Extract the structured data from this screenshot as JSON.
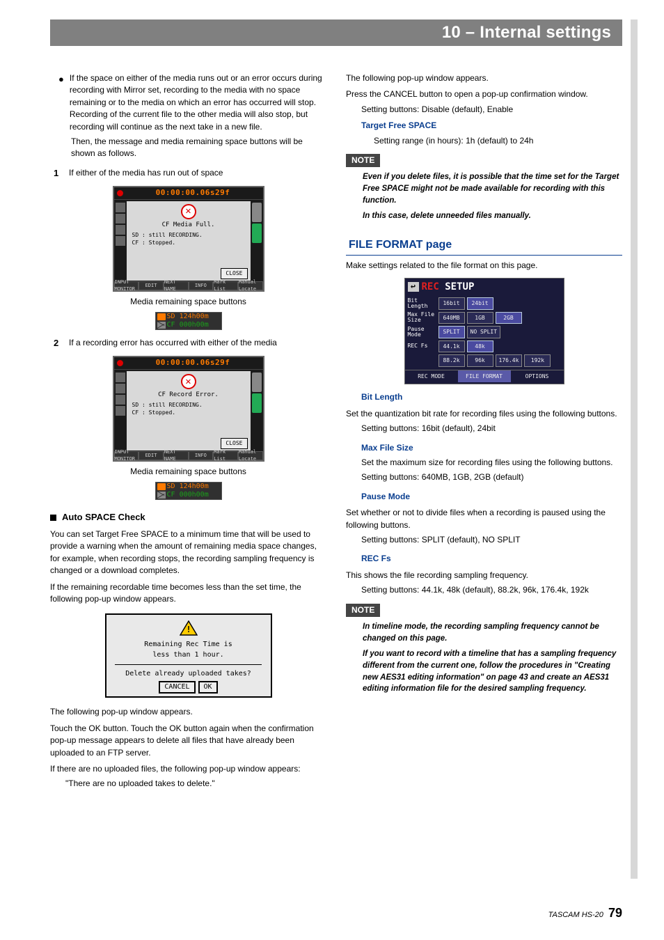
{
  "header": {
    "title": "10 – Internal settings"
  },
  "left": {
    "bullet1": "If the space on either of the media runs out or an error occurs during recording with Mirror set, recording to the media with no space remaining or to the media on which an error has occurred will stop. Recording of the current file to the other media will also stop, but recording will continue as the next take in a new file.",
    "bullet1b": "Then, the message and media remaining space buttons will be shown as follows.",
    "num1_label": "1",
    "num1_text": "If either of the media has run out of space",
    "screen1": {
      "time": "00:00:00.06s29f",
      "title": "CF Media Full.",
      "line1": "SD : still RECORDING.",
      "line2": "CF : Stopped.",
      "close": "CLOSE",
      "tabs": [
        "INPUT MONITOR",
        "EDIT",
        "NEXT NAME",
        "INFO",
        "Mark List",
        "Manual Locate"
      ]
    },
    "caption": "Media remaining space buttons",
    "mini": {
      "sd_label": "SD",
      "sd_val": "124h00m",
      "cf_label": "CF",
      "cf_val": "000h00m"
    },
    "num2_label": "2",
    "num2_text": "If a recording error has occurred with either of the media",
    "screen2": {
      "time": "00:00:00.06s29f",
      "title": "CF Record Error.",
      "line1": "SD : still RECORDING.",
      "line2": "CF : Stopped.",
      "close": "CLOSE",
      "tabs": [
        "INPUT MONITOR",
        "EDIT",
        "NEXT NAME",
        "INFO",
        "Mark List",
        "Manual Locate"
      ]
    },
    "auto_space_heading": "Auto SPACE Check",
    "auto_p1": "You can set Target Free SPACE to a minimum time that will be used to provide a warning when the amount of remaining media space changes, for example, when recording stops, the recording sampling frequency is changed or a download completes.",
    "auto_p2": "If the remaining recordable time becomes less than the set time, the following pop-up window appears.",
    "popup": {
      "l1": "Remaining Rec Time is",
      "l2": "less than 1 hour.",
      "l3": "Delete already uploaded takes?",
      "cancel": "CANCEL",
      "ok": "OK"
    },
    "after_popup1": "The following pop-up window appears.",
    "after_popup2": "Touch the OK button. Touch the OK button again when the confirmation pop-up message appears to delete all files that have already been uploaded to an FTP server.",
    "after_popup3": "If there are no uploaded files, the following pop-up window appears:",
    "after_popup4": "\"There are no uploaded takes to delete.\""
  },
  "right": {
    "p1": "The following pop-up window appears.",
    "p2": "Press the CANCEL button to open a pop-up confirmation window.",
    "p3": "Setting buttons: Disable (default), Enable",
    "tfs_heading": "Target Free SPACE",
    "tfs_body": "Setting range (in hours): 1h (default) to 24h",
    "note1_label": "NOTE",
    "note1_a": "Even if you delete files, it is possible that  the time set for the Target Free SPACE might not be made available for recording with this function.",
    "note1_b": "In this case, delete unneeded files manually.",
    "file_format_heading": "FILE FORMAT page",
    "file_format_intro": "Make settings related to the file format on this page.",
    "rec_setup": {
      "title": "REC SETUP",
      "rows": [
        {
          "label": "Bit Length",
          "buttons": [
            "16bit",
            "24bit"
          ],
          "selected": 1
        },
        {
          "label": "Max File Size",
          "buttons": [
            "640MB",
            "1GB",
            "2GB"
          ],
          "selected": 2
        },
        {
          "label": "Pause Mode",
          "buttons": [
            "SPLIT",
            "NO SPLIT"
          ],
          "selected": 0
        },
        {
          "label": "REC Fs",
          "buttons": [
            "44.1k",
            "48k"
          ],
          "selected": 1
        },
        {
          "label": "",
          "buttons": [
            "88.2k",
            "96k",
            "176.4k",
            "192k"
          ],
          "selected": -1
        }
      ],
      "tabs": [
        "REC MODE",
        "FILE FORMAT",
        "OPTIONS"
      ],
      "active_tab": 1
    },
    "bit_heading": "Bit Length",
    "bit_body": "Set the quantization bit rate for recording files using the following buttons.",
    "bit_setting": "Setting buttons: 16bit (default), 24bit",
    "max_heading": "Max File Size",
    "max_body": "Set the maximum size for recording files using the following buttons.",
    "max_setting": "Setting buttons: 640MB, 1GB, 2GB (default)",
    "pause_heading": "Pause Mode",
    "pause_body": "Set whether or not to divide files when a recording is paused using the following buttons.",
    "pause_setting": "Setting buttons: SPLIT (default), NO SPLIT",
    "recfs_heading": "REC Fs",
    "recfs_body": "This shows the file recording sampling frequency.",
    "recfs_setting": "Setting buttons: 44.1k, 48k (default), 88.2k, 96k, 176.4k, 192k",
    "note2_label": "NOTE",
    "note2_a": "In timeline mode, the recording sampling frequency cannot be changed on this page.",
    "note2_b": "If you want to record with a timeline that has a sampling frequency different from the current one, follow the procedures in \"Creating new AES31 editing information\" on page 43 and create an AES31 editing information file for the desired sampling frequency."
  },
  "footer": {
    "model": "TASCAM HS-20",
    "page": "79"
  }
}
